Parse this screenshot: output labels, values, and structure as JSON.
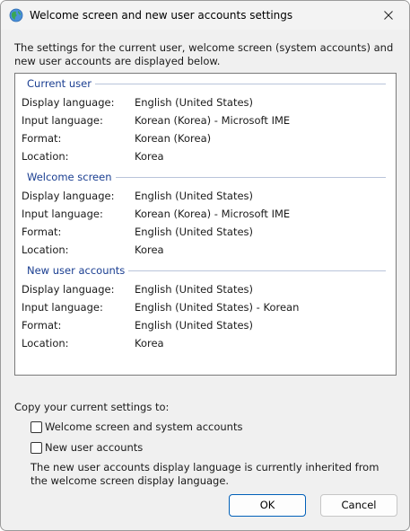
{
  "window": {
    "title": "Welcome screen and new user accounts settings",
    "app_icon": "globe-icon",
    "close_icon": "close-icon"
  },
  "intro_text": "The settings for the current user, welcome screen (system accounts) and new user accounts are displayed below.",
  "groups": [
    {
      "title": "Current user",
      "rows": [
        {
          "label": "Display language:",
          "value": "English (United States)"
        },
        {
          "label": "Input language:",
          "value": "Korean (Korea) - Microsoft IME"
        },
        {
          "label": "Format:",
          "value": "Korean (Korea)"
        },
        {
          "label": "Location:",
          "value": "Korea"
        }
      ]
    },
    {
      "title": "Welcome screen",
      "rows": [
        {
          "label": "Display language:",
          "value": "English (United States)"
        },
        {
          "label": "Input language:",
          "value": "Korean (Korea) - Microsoft IME"
        },
        {
          "label": "Format:",
          "value": "English (United States)"
        },
        {
          "label": "Location:",
          "value": "Korea"
        }
      ]
    },
    {
      "title": "New user accounts",
      "rows": [
        {
          "label": "Display language:",
          "value": "English (United States)"
        },
        {
          "label": "Input language:",
          "value": "English (United States) - Korean"
        },
        {
          "label": "Format:",
          "value": "English (United States)"
        },
        {
          "label": "Location:",
          "value": "Korea"
        }
      ]
    }
  ],
  "copy": {
    "label": "Copy your current settings to:",
    "options": [
      {
        "label": "Welcome screen and system accounts",
        "checked": false
      },
      {
        "label": "New user accounts",
        "checked": false
      }
    ],
    "note": "The new user accounts display language is currently inherited from the welcome screen display language."
  },
  "buttons": {
    "ok": "OK",
    "cancel": "Cancel"
  },
  "colors": {
    "group_title": "#1a3e91",
    "primary_border": "#005fb8"
  }
}
